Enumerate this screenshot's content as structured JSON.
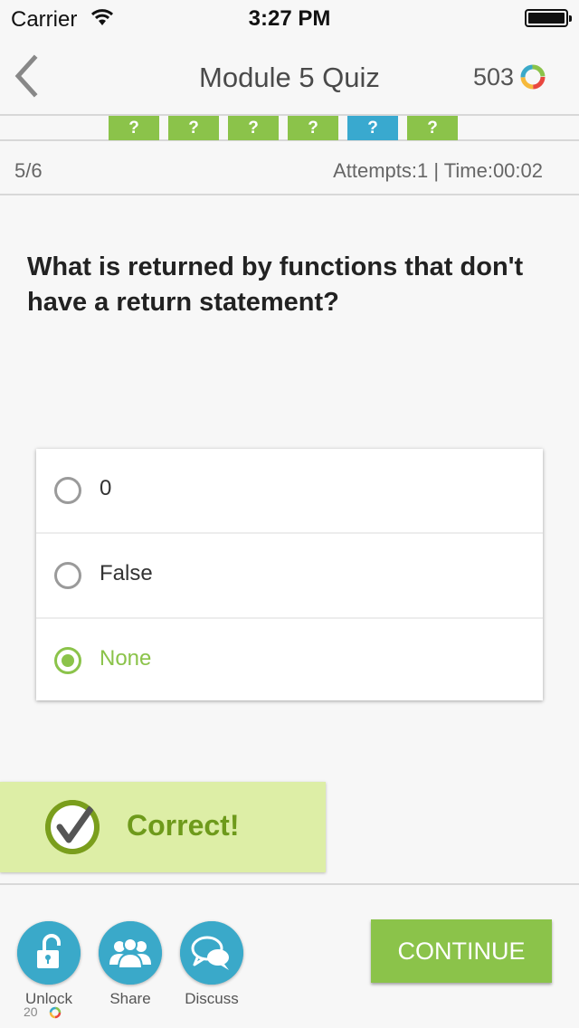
{
  "status_bar": {
    "carrier": "Carrier",
    "time": "3:27 PM"
  },
  "nav": {
    "title": "Module 5 Quiz",
    "xp": "503",
    "back_icon": "chevron-left-icon",
    "xp_icon": "sololearn-logo-icon"
  },
  "progress": {
    "steps": [
      {
        "label": "?",
        "color": "#8bc34a"
      },
      {
        "label": "?",
        "color": "#8bc34a"
      },
      {
        "label": "?",
        "color": "#8bc34a"
      },
      {
        "label": "?",
        "color": "#8bc34a"
      },
      {
        "label": "?",
        "color": "#39a9cf"
      },
      {
        "label": "?",
        "color": "#8bc34a"
      }
    ]
  },
  "info": {
    "counter": "5/6",
    "attempts_time": "Attempts:1 | Time:00:02"
  },
  "question": "What is returned by functions that don't have a return statement?",
  "answers": [
    {
      "label": "0",
      "selected": false
    },
    {
      "label": "False",
      "selected": false
    },
    {
      "label": "None",
      "selected": true
    }
  ],
  "result": {
    "text": "Correct!",
    "icon": "checkmark-icon"
  },
  "actions": {
    "unlock": {
      "label": "Unlock",
      "cost": "20",
      "icon": "unlock-icon"
    },
    "share": {
      "label": "Share",
      "icon": "people-icon"
    },
    "discuss": {
      "label": "Discuss",
      "icon": "speech-bubbles-icon"
    }
  },
  "continue_label": "CONTINUE",
  "colors": {
    "accent_green": "#8bc34a",
    "accent_blue": "#39a9cf",
    "correct_bg": "#ddeea6",
    "correct_text": "#6e9a1b"
  }
}
